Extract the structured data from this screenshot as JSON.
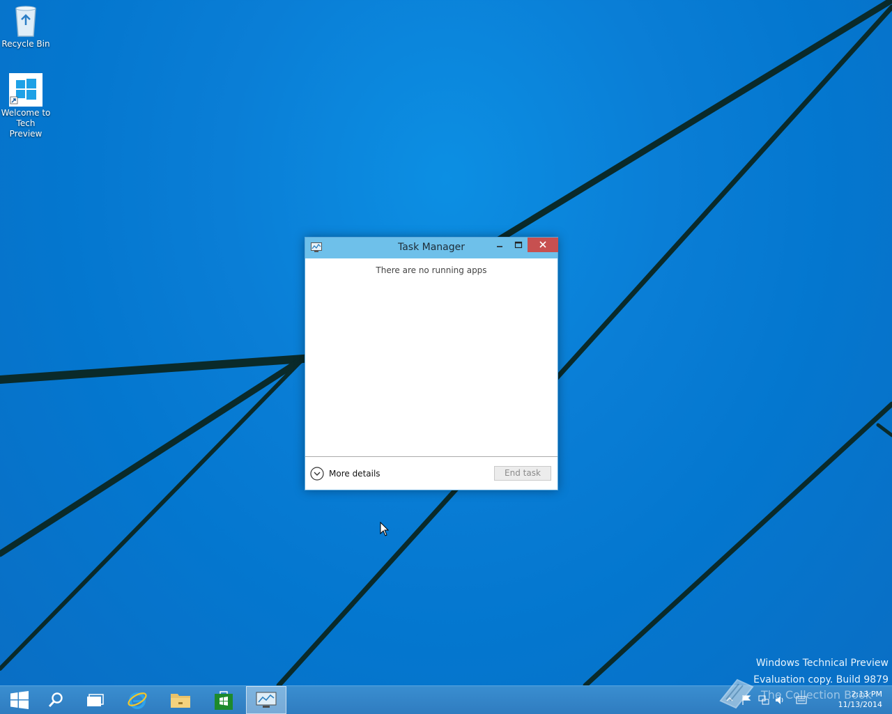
{
  "desktop": {
    "icons": [
      {
        "label": "Recycle Bin",
        "icon": "recycle-bin-icon"
      },
      {
        "label": "Welcome to Tech Preview",
        "icon": "windows-logo-icon"
      }
    ]
  },
  "task_manager": {
    "title": "Task Manager",
    "empty_message": "There are no running apps",
    "more_details_label": "More details",
    "end_task_label": "End task"
  },
  "watermark": {
    "line1": "Windows Technical Preview",
    "line2": "Evaluation copy. Build 9879"
  },
  "overlay_logo_text": "The Collection Book",
  "taskbar": {
    "buttons": [
      "start-icon",
      "search-icon",
      "task-view-icon",
      "internet-explorer-icon",
      "file-explorer-icon",
      "store-icon",
      "task-manager-icon"
    ],
    "clock_time": "2:13 PM",
    "clock_date": "11/13/2014"
  },
  "colors": {
    "desktop_bg": "#0a7ed6",
    "titlebar": "#6ec0ea",
    "close_button": "#c75050",
    "taskbar": "#2f7cc0"
  }
}
